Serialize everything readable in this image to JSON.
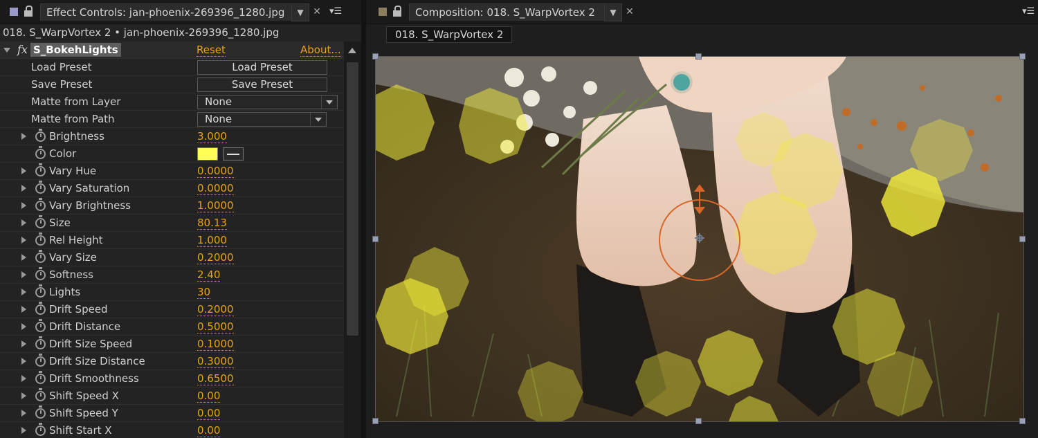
{
  "effect_controls": {
    "tab_title": "Effect Controls: jan-phoenix-269396_1280.jpg",
    "subtitle": "018. S_WarpVortex 2 • jan-phoenix-269396_1280.jpg",
    "effect": {
      "name": "S_BokehLights",
      "fx_glyph": "fx",
      "reset_label": "Reset",
      "about_label": "About..."
    },
    "preset_rows": [
      {
        "label": "Load Preset",
        "button": "Load Preset"
      },
      {
        "label": "Save Preset",
        "button": "Save Preset"
      }
    ],
    "select_rows": [
      {
        "label": "Matte from Layer",
        "value": "None"
      },
      {
        "label": "Matte from Path",
        "value": "None"
      }
    ],
    "brightness": {
      "label": "Brightness",
      "value": "3.000"
    },
    "color": {
      "label": "Color",
      "swatch": "#ffff55"
    },
    "params": [
      {
        "label": "Vary Hue",
        "value": "0.0000"
      },
      {
        "label": "Vary Saturation",
        "value": "0.0000"
      },
      {
        "label": "Vary Brightness",
        "value": "1.0000"
      },
      {
        "label": "Size",
        "value": "80.13"
      },
      {
        "label": "Rel Height",
        "value": "1.000"
      },
      {
        "label": "Vary Size",
        "value": "0.2000"
      },
      {
        "label": "Softness",
        "value": "2.40"
      },
      {
        "label": "Lights",
        "value": "30"
      },
      {
        "label": "Drift Speed",
        "value": "0.2000"
      },
      {
        "label": "Drift Distance",
        "value": "0.5000"
      },
      {
        "label": "Drift Size Speed",
        "value": "0.1000"
      },
      {
        "label": "Drift Size Distance",
        "value": "0.3000"
      },
      {
        "label": "Drift Smoothness",
        "value": "0.6500"
      },
      {
        "label": "Shift Speed X",
        "value": "0.00"
      },
      {
        "label": "Shift Speed Y",
        "value": "0.00"
      },
      {
        "label": "Shift Start X",
        "value": "0.00"
      }
    ]
  },
  "composition": {
    "tab_title": "Composition: 018. S_WarpVortex 2",
    "subtab": "018. S_WarpVortex 2"
  },
  "colors": {
    "accent_value": "#e8a317",
    "bokeh": "#f2ec3a",
    "vortex_ring": "#d9662a"
  }
}
